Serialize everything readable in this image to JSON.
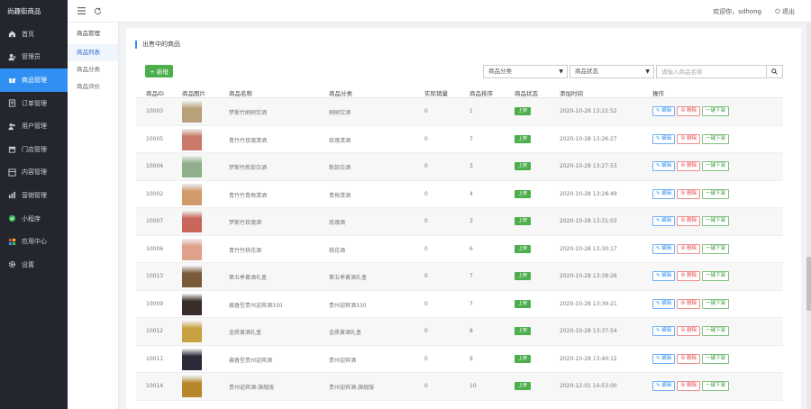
{
  "brand": "尚趣街商品",
  "sidebar": {
    "items": [
      {
        "label": "首页",
        "icon": "home-icon"
      },
      {
        "label": "管理员",
        "icon": "user-admin-icon"
      },
      {
        "label": "商品管理",
        "icon": "gift-icon",
        "active": true
      },
      {
        "label": "订单管理",
        "icon": "order-icon"
      },
      {
        "label": "用户管理",
        "icon": "users-icon"
      },
      {
        "label": "门店管理",
        "icon": "store-icon"
      },
      {
        "label": "内容管理",
        "icon": "content-icon"
      },
      {
        "label": "营销管理",
        "icon": "marketing-icon"
      },
      {
        "label": "小程序",
        "icon": "miniapp-icon"
      },
      {
        "label": "应用中心",
        "icon": "apps-icon"
      },
      {
        "label": "设置",
        "icon": "gear-icon"
      }
    ]
  },
  "subnav": {
    "title": "商品管理",
    "items": [
      {
        "label": "商品列表",
        "active": true
      },
      {
        "label": "商品分类"
      },
      {
        "label": "商品评价"
      }
    ]
  },
  "topbar": {
    "welcome": "欢迎你，sdhong",
    "logout": "退出"
  },
  "panel": {
    "title": "出售中的商品",
    "add_label": "+ 新增",
    "category_select": "商品分类",
    "status_select": "商品状态",
    "search_placeholder": "请输入商品名称"
  },
  "table": {
    "headers": {
      "id": "商品ID",
      "image": "商品图片",
      "name": "商品名称",
      "category": "商品分类",
      "sales": "实际销量",
      "sort": "商品排序",
      "status": "商品状态",
      "added": "添加时间",
      "ops": "操作"
    },
    "ops": {
      "edit": "✎ 编辑",
      "delete": "⊗ 删除",
      "off": "一键下架"
    },
    "rows": [
      {
        "id": "10003",
        "name": "梦斯竹刷刷饮酒",
        "category": "刷刷饮酒",
        "sales": "0",
        "sort": "1",
        "status": "上架",
        "time": "2020-10-28 13:22:52",
        "thumb": "#b8a07a"
      },
      {
        "id": "10005",
        "name": "青竹竹玫瑰清酒",
        "category": "玫瑰清酒",
        "sales": "0",
        "sort": "7",
        "status": "上架",
        "time": "2020-10-28 13:26:27",
        "thumb": "#c97a6a"
      },
      {
        "id": "10004",
        "name": "梦斯竹新款白酒",
        "category": "新款白酒",
        "sales": "0",
        "sort": "3",
        "status": "上架",
        "time": "2020-10-28 13:27:53",
        "thumb": "#8fae8a"
      },
      {
        "id": "10002",
        "name": "青竹竹青梅清酒",
        "category": "青梅清酒",
        "sales": "0",
        "sort": "4",
        "status": "上架",
        "time": "2020-10-28 13:28:49",
        "thumb": "#d29a6a"
      },
      {
        "id": "10007",
        "name": "梦斯竹玫瑰酒",
        "category": "玫瑰酒",
        "sales": "0",
        "sort": "3",
        "status": "上架",
        "time": "2020-10-28 13:31:03",
        "thumb": "#c9665a"
      },
      {
        "id": "10006",
        "name": "青竹竹桃花酒",
        "category": "桃花酒",
        "sales": "0",
        "sort": "6",
        "status": "上架",
        "time": "2020-10-28 13:30:17",
        "thumb": "#e0a08a"
      },
      {
        "id": "10013",
        "name": "第五季黄酒礼盒",
        "category": "第五季黄酒礼盒",
        "sales": "0",
        "sort": "7",
        "status": "上架",
        "time": "2020-10-28 13:38:26",
        "thumb": "#7a5a3a"
      },
      {
        "id": "10009",
        "name": "酱香型贵州迎宾酒330",
        "category": "贵州迎宾酒330",
        "sales": "0",
        "sort": "7",
        "status": "上架",
        "time": "2020-10-28 13:39:21",
        "thumb": "#3a2e2a"
      },
      {
        "id": "10012",
        "name": "金质黄酒礼盒",
        "category": "金质黄酒礼盒",
        "sales": "0",
        "sort": "8",
        "status": "上架",
        "time": "2020-10-28 13:37:54",
        "thumb": "#c9a040"
      },
      {
        "id": "10011",
        "name": "酱香型贵州迎宾酒",
        "category": "贵州迎宾酒",
        "sales": "0",
        "sort": "9",
        "status": "上架",
        "time": "2020-10-28 13:40:12",
        "thumb": "#2a2a3a"
      },
      {
        "id": "10014",
        "name": "贵州迎宾酒-旗舰版",
        "category": "贵州迎宾酒-旗舰版",
        "sales": "0",
        "sort": "10",
        "status": "上架",
        "time": "2020-12-01 14:53:00",
        "thumb": "#b8862a"
      }
    ]
  }
}
